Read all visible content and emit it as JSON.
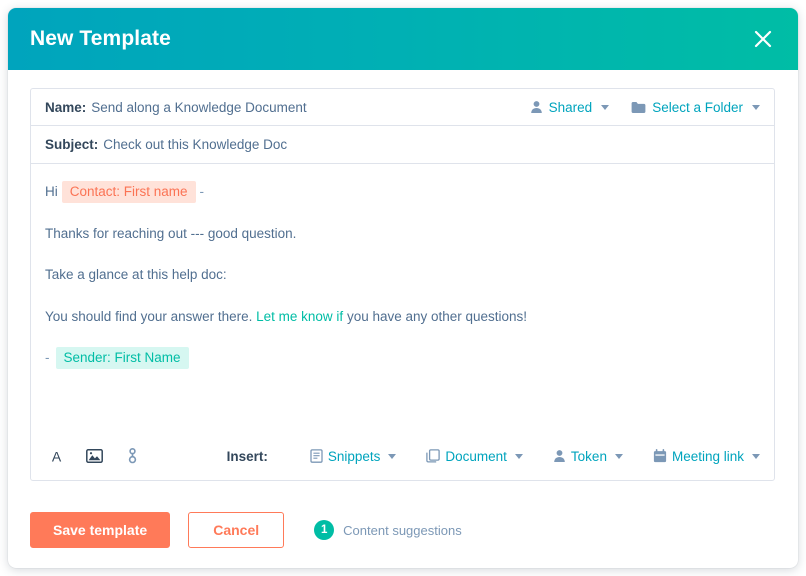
{
  "dialog": {
    "title": "New Template",
    "close_icon": "close-x-icon",
    "header_gradient_start": "#00A4BD",
    "header_gradient_end": "#00BDA5"
  },
  "fields": {
    "name_label": "Name:",
    "name_value": "Send along a Knowledge Document",
    "subject_label": "Subject:",
    "subject_value": "Check out this Knowledge Doc",
    "sharing": {
      "icon": "person-icon",
      "label": "Shared"
    },
    "folder": {
      "icon": "folder-icon",
      "label": "Select a Folder"
    }
  },
  "compose": {
    "greeting_prefix": "Hi",
    "contact_token": "Contact: First name",
    "greeting_suffix": "-",
    "line_2": "Thanks for reaching out --- good question.",
    "line_3": "Take a glance at this help doc:",
    "line_4_prefix": "You should find your answer there. ",
    "line_4_link": "Let me know if",
    "line_4_suffix": " you have any other questions!",
    "signoff_dash": "-",
    "sender_token": "Sender: First Name",
    "token_contact_bg": "#ffe2d9",
    "token_contact_fg": "#fb7354",
    "token_sender_bg": "#d6f7f1",
    "token_sender_fg": "#00bda5",
    "link_color": "#00bda5"
  },
  "toolbar": {
    "format_icons": [
      {
        "name": "font-color-icon",
        "glyph": "A"
      },
      {
        "name": "insert-image-icon",
        "glyph": "image"
      },
      {
        "name": "insert-link-icon",
        "glyph": "link"
      }
    ],
    "insert_label": "Insert:",
    "insert_items": [
      {
        "name": "snippets",
        "label": "Snippets",
        "icon": "document-page-icon"
      },
      {
        "name": "document",
        "label": "Document",
        "icon": "copy-pages-icon"
      },
      {
        "name": "token",
        "label": "Token",
        "icon": "person-icon"
      },
      {
        "name": "meeting-link",
        "label": "Meeting link",
        "icon": "calendar-icon"
      }
    ]
  },
  "footer": {
    "save_label": "Save template",
    "cancel_label": "Cancel",
    "suggestions_count": "1",
    "suggestions_label": "Content suggestions",
    "primary_color": "#ff7a59",
    "badge_color": "#00bda5"
  }
}
